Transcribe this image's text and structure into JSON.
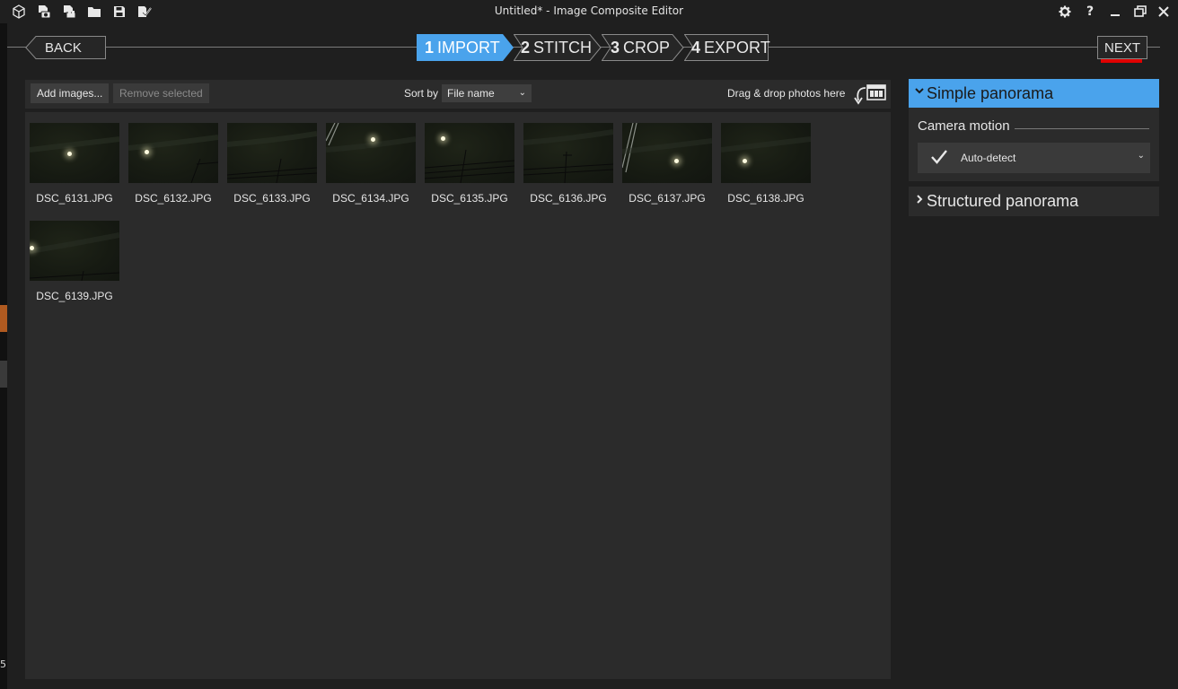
{
  "window": {
    "title": "Untitled* - Image Composite Editor",
    "quick_access_icons": [
      "new-panorama-icon",
      "new-from-video-icon",
      "new-from-images-icon",
      "open-icon",
      "save-icon",
      "publish-icon"
    ],
    "controls": [
      "settings-icon",
      "help-icon",
      "minimize-icon",
      "restore-icon",
      "close-icon"
    ],
    "help_glyph": "?",
    "side_strip_digit": "5"
  },
  "nav": {
    "back_label": "BACK",
    "next_label": "NEXT",
    "steps": [
      {
        "num": "1",
        "label": "IMPORT",
        "active": true
      },
      {
        "num": "2",
        "label": "STITCH",
        "active": false
      },
      {
        "num": "3",
        "label": "CROP",
        "active": false
      },
      {
        "num": "4",
        "label": "EXPORT",
        "active": false
      }
    ],
    "accent_color": "#4aa3ec",
    "highlight_color": "#e00000"
  },
  "toolbar": {
    "add_images": "Add images...",
    "remove_selected": "Remove selected",
    "sort_by_label": "Sort by",
    "sort_value": "File name",
    "drag_drop_hint": "Drag & drop photos here"
  },
  "images": [
    {
      "name": "DSC_6131.JPG"
    },
    {
      "name": "DSC_6132.JPG"
    },
    {
      "name": "DSC_6133.JPG"
    },
    {
      "name": "DSC_6134.JPG"
    },
    {
      "name": "DSC_6135.JPG"
    },
    {
      "name": "DSC_6136.JPG"
    },
    {
      "name": "DSC_6137.JPG"
    },
    {
      "name": "DSC_6138.JPG"
    },
    {
      "name": "DSC_6139.JPG"
    }
  ],
  "panel": {
    "simple_panorama": "Simple panorama",
    "camera_motion_label": "Camera motion",
    "camera_motion_value": "Auto-detect",
    "structured_panorama": "Structured panorama"
  }
}
